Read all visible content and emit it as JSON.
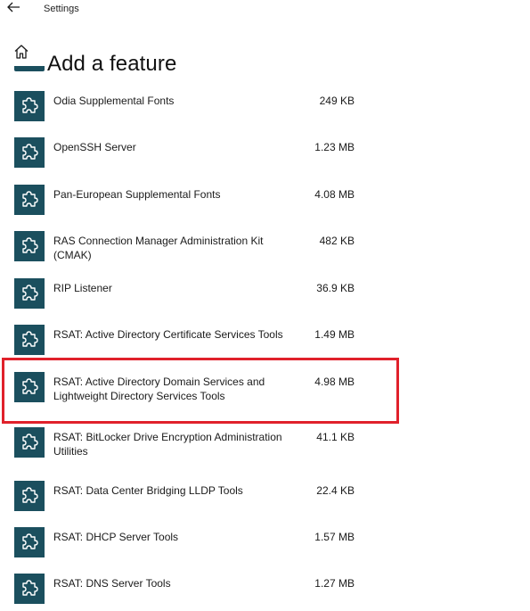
{
  "window": {
    "title": "Settings"
  },
  "header": {
    "title": "Add a feature"
  },
  "icons": {
    "back": "back-arrow-icon",
    "home": "home-icon",
    "feature": "puzzle-piece-icon"
  },
  "colors": {
    "tile": "#1b4f5e",
    "highlight": "#e0212b"
  },
  "features": [
    {
      "name": "Odia Supplemental Fonts",
      "size": "249 KB"
    },
    {
      "name": "OpenSSH Server",
      "size": "1.23 MB"
    },
    {
      "name": "Pan-European Supplemental Fonts",
      "size": "4.08 MB"
    },
    {
      "name": "RAS Connection Manager Administration Kit (CMAK)",
      "size": "482 KB"
    },
    {
      "name": "RIP Listener",
      "size": "36.9 KB"
    },
    {
      "name": "RSAT: Active Directory Certificate Services Tools",
      "size": "1.49 MB"
    },
    {
      "name": "RSAT: Active Directory Domain Services and Lightweight Directory Services Tools",
      "size": "4.98 MB",
      "highlighted": true
    },
    {
      "name": "RSAT: BitLocker Drive Encryption Administration Utilities",
      "size": "41.1 KB"
    },
    {
      "name": "RSAT: Data Center Bridging LLDP Tools",
      "size": "22.4 KB"
    },
    {
      "name": "RSAT: DHCP Server Tools",
      "size": "1.57 MB"
    },
    {
      "name": "RSAT: DNS Server Tools",
      "size": "1.27 MB"
    }
  ]
}
